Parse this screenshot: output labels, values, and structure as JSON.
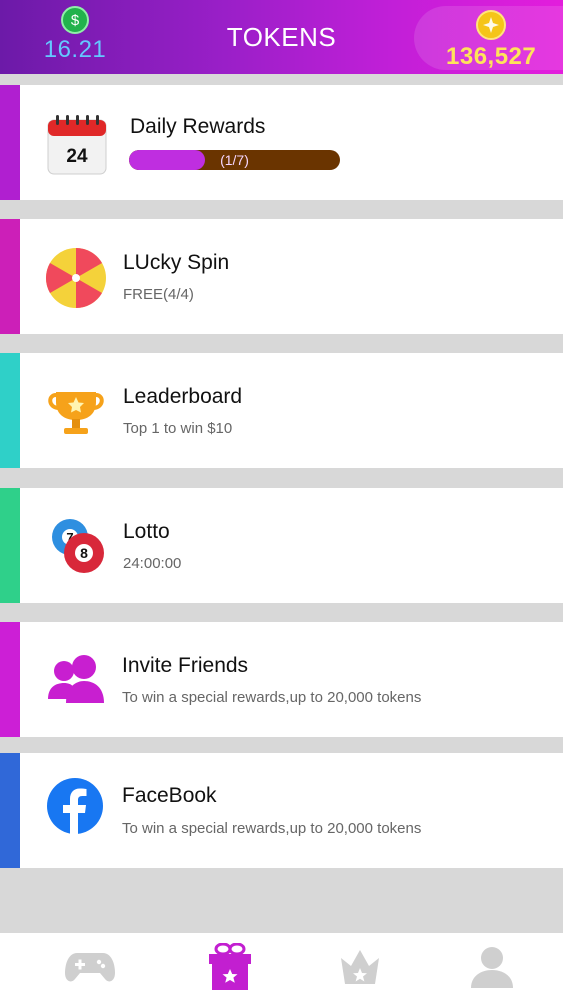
{
  "header": {
    "title": "TOKENS",
    "cash_value": "16.21",
    "coin_value": "136,527"
  },
  "colors": {
    "header_start": "#6c1aa8",
    "header_end": "#e31ddc",
    "progress_fill": "#bf2ee0",
    "progress_track": "#6a3400"
  },
  "items": [
    {
      "name": "Daily Rewards",
      "sub": "",
      "icon": "calendar-icon",
      "calendar_day": "24",
      "progress_label": "(1/7)",
      "progress_fraction": 0.36,
      "accent": "#b01fd0"
    },
    {
      "name": "LUcky Spin",
      "sub": "FREE(4/4)",
      "icon": "lucky-spin-icon",
      "accent": "#cc1fb8"
    },
    {
      "name": "Leaderboard",
      "sub": "Top 1 to win $10",
      "icon": "trophy-icon",
      "accent": "#2fd0c8"
    },
    {
      "name": "Lotto",
      "sub": "24:00:00",
      "icon": "lotto-balls-icon",
      "ball_a": "7",
      "ball_b": "8",
      "accent": "#2fd08a"
    },
    {
      "name": "Invite Friends",
      "sub": "To win a special rewards,up to 20,000 tokens",
      "icon": "friends-icon",
      "accent": "#cc1fd6"
    },
    {
      "name": "FaceBook",
      "sub": "To win a special rewards,up to 20,000 tokens",
      "icon": "facebook-icon",
      "accent": "#3068d8"
    }
  ],
  "tabs": [
    {
      "icon": "gamepad-icon",
      "active": false
    },
    {
      "icon": "gift-icon",
      "active": true
    },
    {
      "icon": "crown-icon",
      "active": false
    },
    {
      "icon": "profile-icon",
      "active": false
    }
  ]
}
